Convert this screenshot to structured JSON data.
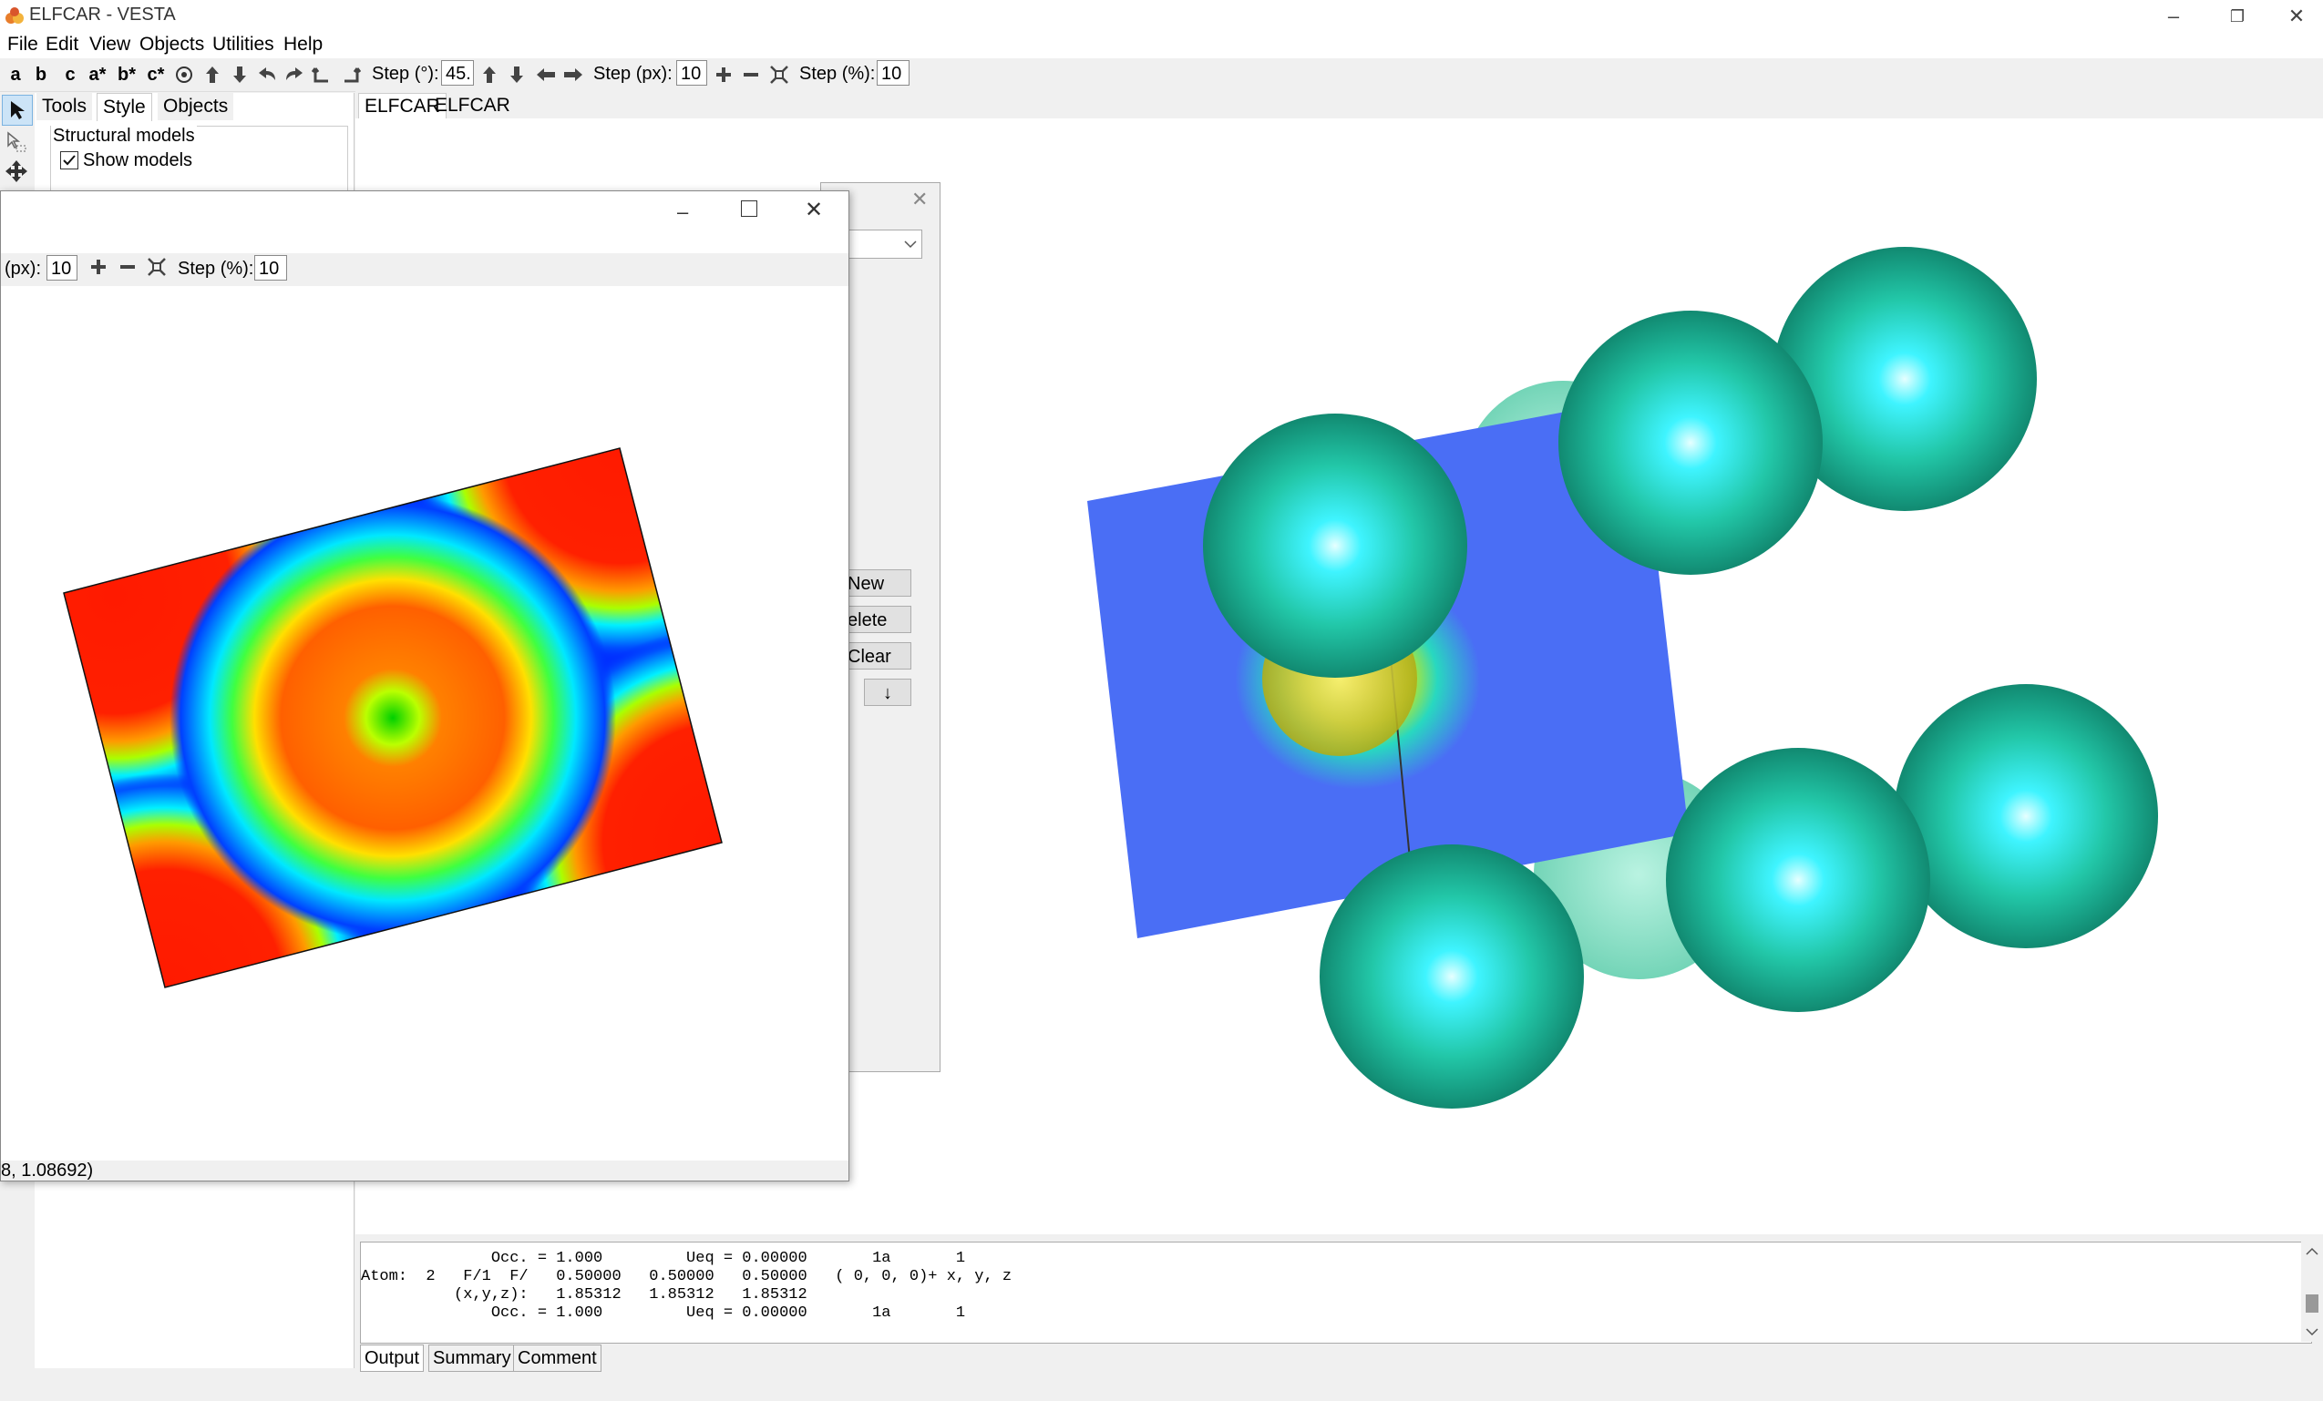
{
  "window": {
    "title": "ELFCAR - VESTA",
    "controls": [
      "–",
      "❐",
      "✕"
    ]
  },
  "menu": [
    "File",
    "Edit",
    "View",
    "Objects",
    "Utilities",
    "Help"
  ],
  "toolbar": {
    "axis_buttons": [
      "a",
      "b",
      "c",
      "a*",
      "b*",
      "c*"
    ],
    "step_deg_label": "Step (°):",
    "step_deg_value": "45.",
    "step_px_label": "Step (px):",
    "step_px_value": "10",
    "step_pct_label": "Step (%):",
    "step_pct_value": "10"
  },
  "left_panel": {
    "tabs": [
      "Tools",
      "Style",
      "Objects"
    ],
    "group_title": "Structural models",
    "show_models_label": "Show models",
    "show_models_checked": true
  },
  "doc_tabs": [
    "ELFCAR",
    "ELFCAR"
  ],
  "bg_dialog": {
    "buttons": [
      "New",
      "elete",
      "Clear",
      "↓"
    ]
  },
  "slice_window": {
    "step_px_label": "(px):",
    "step_px_value": "10",
    "step_pct_label": "Step (%):",
    "step_pct_value": "10",
    "status": "8, 1.08692)"
  },
  "output": {
    "lines": [
      "              Occ. = 1.000         Ueq = 0.00000       1a       1",
      "Atom:  2   F/1  F/   0.50000   0.50000   0.50000   ( 0, 0, 0)+ x, y, z",
      "          (x,y,z):   1.85312   1.85312   1.85312",
      "              Occ. = 1.000         Ueq = 0.00000       1a       1"
    ],
    "tabs": [
      "Output",
      "Summary",
      "Comment"
    ]
  }
}
